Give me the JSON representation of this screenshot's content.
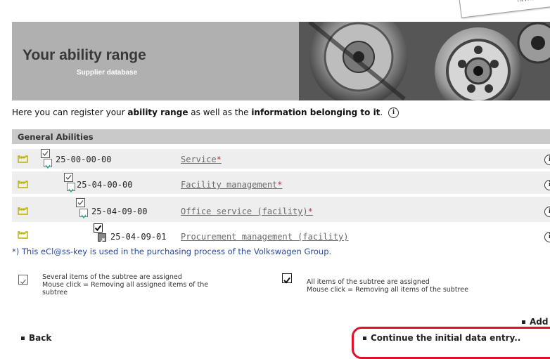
{
  "banner": {
    "title": "Your ability range",
    "subtitle": "Supplier database"
  },
  "intro": {
    "part1": "Here you can register your ",
    "bold1": "ability range",
    "part2": " as well as the ",
    "bold2": "information belonging to it",
    "part3": ". ",
    "info_glyph": "i"
  },
  "section": {
    "title": "General Abilities"
  },
  "rows": [
    {
      "code": "25-00-00-00",
      "label": "Service",
      "starred": "*",
      "info_glyph": "i"
    },
    {
      "code": "25-04-00-00",
      "label": "Facility management",
      "starred": "*",
      "info_glyph": "i"
    },
    {
      "code": "25-04-09-00",
      "label": "Office service (facility)",
      "starred": "*",
      "info_glyph": "i"
    },
    {
      "code": "25-04-09-01",
      "label": "Procurement management (facility)",
      "starred": "",
      "info_glyph": "i"
    }
  ],
  "footnote": "*) This eCl@ss-key is used in the purchasing process of the Volkswagen Group.",
  "legend": {
    "partial_line1": "Several items of the subtree are assigned",
    "partial_line2": "Mouse click = Removing all assigned items of the",
    "partial_line3": "subtree",
    "full_line1": "All items of the subtree are assigned",
    "full_line2": "Mouse click = Removing all items of the subtree"
  },
  "nav": {
    "back": "Back",
    "add": "Add",
    "continue": "Continue the initial data entry.."
  },
  "colors": {
    "banner_bg": "#b0b0b0",
    "section_bg": "#c9c9c9",
    "row_bg": "#eeeeee",
    "footnote": "#2a4a9a",
    "highlight": "#e0102a",
    "factory_icon": "#b8b000"
  }
}
